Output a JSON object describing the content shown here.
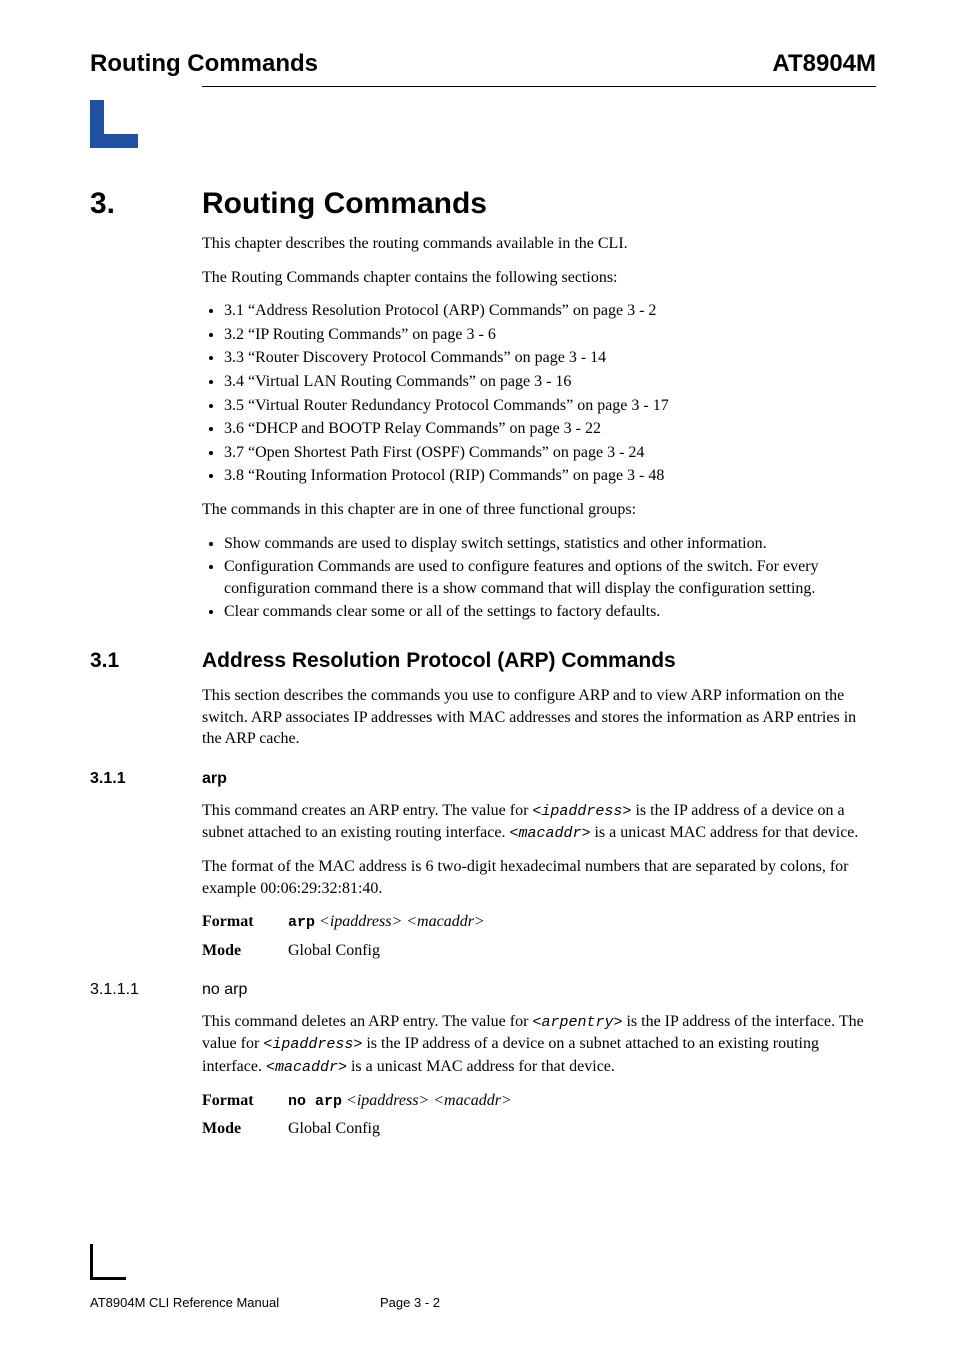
{
  "header": {
    "left": "Routing Commands",
    "right": "AT8904M"
  },
  "chapter": {
    "number": "3.",
    "title": "Routing Commands",
    "intro1": "This chapter describes the routing commands available in the CLI.",
    "intro2": "The Routing Commands chapter contains the following sections:",
    "toc": [
      "3.1 “Address Resolution Protocol (ARP) Commands” on page 3 - 2",
      "3.2 “IP Routing Commands” on page 3 - 6",
      "3.3 “Router Discovery Protocol Commands” on page 3 - 14",
      "3.4 “Virtual LAN Routing Commands” on page 3 - 16",
      "3.5 “Virtual Router Redundancy Protocol Commands” on page 3 - 17",
      "3.6 “DHCP and BOOTP Relay Commands” on page 3 - 22",
      "3.7 “Open Shortest Path First (OSPF) Commands” on page 3 - 24",
      "3.8 “Routing Information Protocol (RIP) Commands” on page 3 - 48"
    ],
    "groups_intro": "The commands in this chapter are in one of three functional groups:",
    "groups": [
      "Show commands are used to display switch settings, statistics and other information.",
      "Configuration Commands are used to configure features and options of the switch. For every configuration command there is a show command that will display the configuration setting.",
      "Clear commands clear some or all of the settings to factory defaults."
    ]
  },
  "sec31": {
    "num": "3.1",
    "title": "Address Resolution Protocol (ARP) Commands",
    "p1": "This section describes the commands you use to configure ARP and to view ARP information on the switch. ARP associates IP addresses with MAC addresses and stores the information as ARP entries in the ARP cache."
  },
  "sec311": {
    "num": "3.1.1",
    "title": "arp",
    "p1_a": "This command creates an ARP entry. The value for ",
    "p1_code1": "<ipaddress>",
    "p1_b": " is the IP address of a device on a subnet attached to an existing routing interface. ",
    "p1_code2": "<macaddr>",
    "p1_c": " is a unicast MAC address for that device.",
    "p2": "The format of the MAC address is 6 two-digit hexadecimal numbers that are separated by colons, for example 00:06:29:32:81:40.",
    "format_label": "Format",
    "format_cmd": "arp",
    "format_args": "<ipaddress> <macaddr>",
    "mode_label": "Mode",
    "mode_val": "Global Config"
  },
  "sec3111": {
    "num": "3.1.1.1",
    "title": "no arp",
    "p1_a": "This command deletes an ARP entry. The value for ",
    "p1_code1": "<arpentry>",
    "p1_b": " is the IP address of the interface. The value for ",
    "p1_code2": "<ipaddress>",
    "p1_c": " is the IP address of a device on a subnet attached to an existing routing interface. ",
    "p1_code3": "<macaddr>",
    "p1_d": " is a unicast MAC address for that device.",
    "format_label": "Format",
    "format_cmd": "no arp",
    "format_args": "<ipaddress> <macaddr>",
    "mode_label": "Mode",
    "mode_val": "Global Config"
  },
  "footer": {
    "left": "AT8904M CLI Reference Manual",
    "center": "Page 3 - 2"
  }
}
